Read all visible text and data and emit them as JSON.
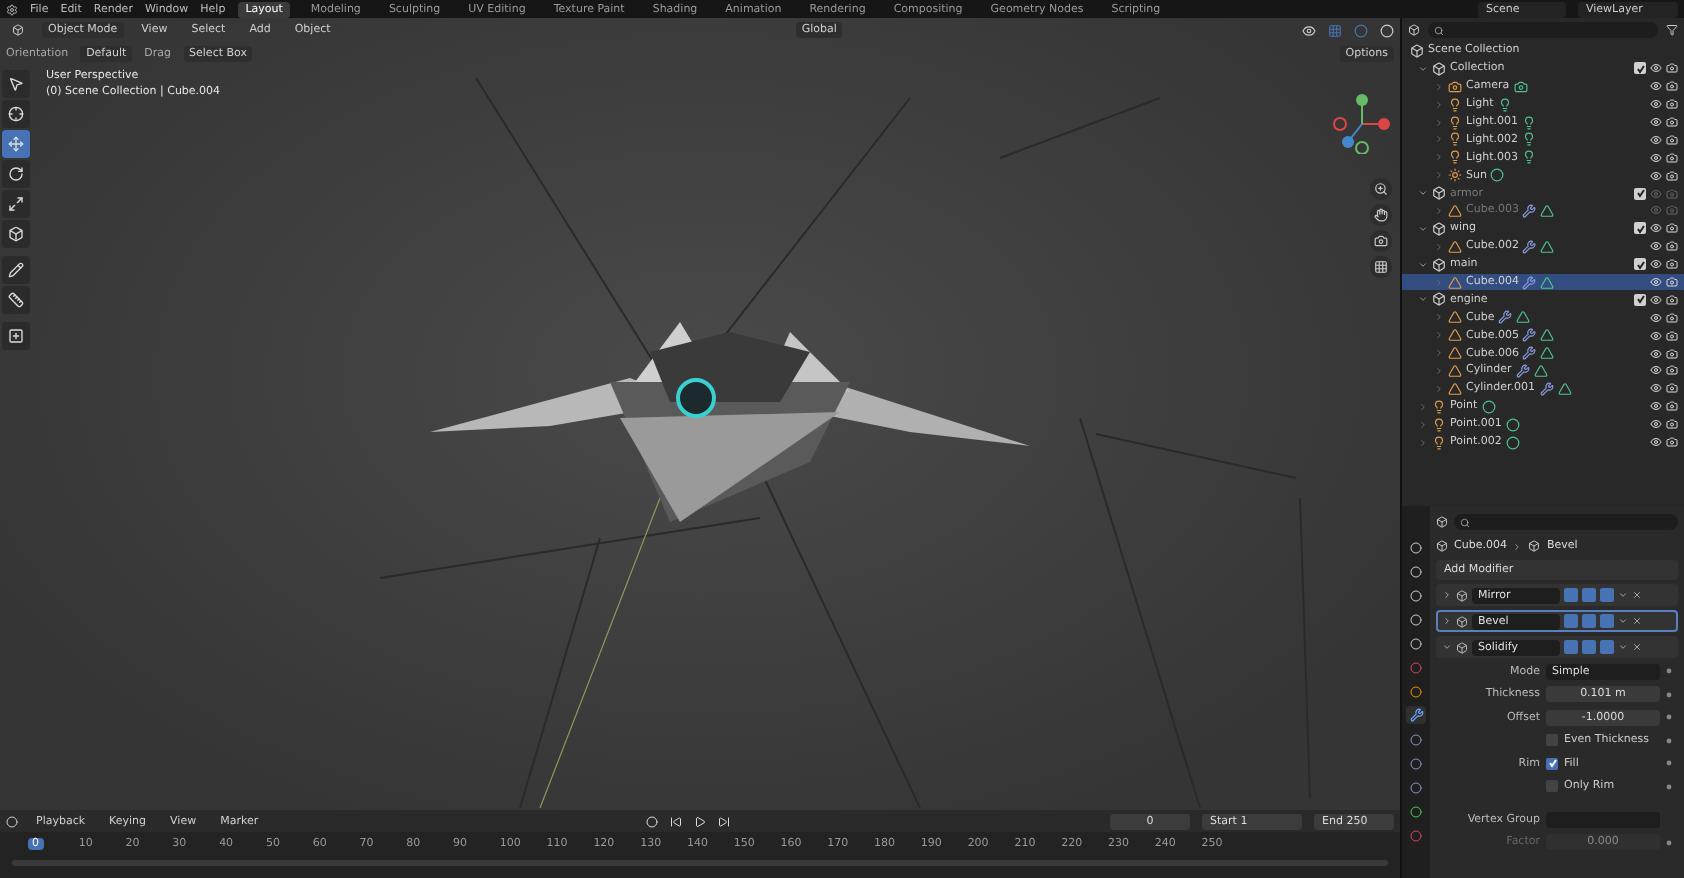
{
  "top_bar": {
    "menus": [
      "File",
      "Edit",
      "Render",
      "Window",
      "Help"
    ],
    "workspaces": [
      {
        "label": "Layout",
        "selected": true
      },
      {
        "label": "Modeling",
        "selected": false
      },
      {
        "label": "Sculpting",
        "selected": false
      },
      {
        "label": "UV Editing",
        "selected": false
      },
      {
        "label": "Texture Paint",
        "selected": false
      },
      {
        "label": "Shading",
        "selected": false
      },
      {
        "label": "Animation",
        "selected": false
      },
      {
        "label": "Rendering",
        "selected": false
      },
      {
        "label": "Compositing",
        "selected": false
      },
      {
        "label": "Geometry Nodes",
        "selected": false
      },
      {
        "label": "Scripting",
        "selected": false
      }
    ],
    "scene": "Scene",
    "view_layer": "ViewLayer"
  },
  "viewport": {
    "mode": "Object Mode",
    "menus": [
      "View",
      "Select",
      "Add",
      "Object"
    ],
    "transform": "Global",
    "orientation_label": "Orientation",
    "orientation": "Default",
    "drag_label": "Drag",
    "drag": "Select Box",
    "options": "Options",
    "perspective": "User Perspective",
    "context": "(0) Scene Collection | Cube.004",
    "tools": [
      {
        "kind": "select",
        "selected": false
      },
      {
        "kind": "cursor",
        "selected": false
      },
      {
        "kind": "move",
        "selected": true
      },
      {
        "kind": "rotate",
        "selected": false
      },
      {
        "kind": "scale",
        "selected": false
      },
      {
        "kind": "transform",
        "selected": false
      },
      {
        "kind": "annotate",
        "selected": false
      },
      {
        "kind": "measure",
        "selected": false
      },
      {
        "kind": "add",
        "selected": false
      }
    ]
  },
  "outliner": {
    "root": "Scene Collection",
    "items": [
      {
        "label": "Collection",
        "kind": "collection",
        "checked": true,
        "selected": false,
        "disabled": false,
        "children": [
          {
            "label": "Camera",
            "kind": "camera",
            "selected": false,
            "disabled": false
          },
          {
            "label": "Light",
            "kind": "light",
            "selected": false,
            "disabled": false
          },
          {
            "label": "Light.001",
            "kind": "light",
            "selected": false,
            "disabled": false
          },
          {
            "label": "Light.002",
            "kind": "light",
            "selected": false,
            "disabled": false
          },
          {
            "label": "Light.003",
            "kind": "light",
            "selected": false,
            "disabled": false
          },
          {
            "label": "Sun",
            "kind": "sun",
            "selected": false,
            "disabled": false
          }
        ]
      },
      {
        "label": "armor",
        "kind": "collection",
        "checked": true,
        "selected": false,
        "disabled": true,
        "children": [
          {
            "label": "Cube.003",
            "kind": "mesh",
            "selected": false,
            "disabled": true
          }
        ]
      },
      {
        "label": "wing",
        "kind": "collection",
        "checked": true,
        "selected": false,
        "disabled": false,
        "children": [
          {
            "label": "Cube.002",
            "kind": "mesh",
            "selected": false,
            "disabled": false
          }
        ]
      },
      {
        "label": "main",
        "kind": "collection",
        "checked": true,
        "selected": false,
        "disabled": false,
        "children": [
          {
            "label": "Cube.004",
            "kind": "mesh",
            "selected": true,
            "disabled": false
          }
        ]
      },
      {
        "label": "engine",
        "kind": "collection",
        "checked": true,
        "selected": false,
        "disabled": false,
        "children": [
          {
            "label": "Cube",
            "kind": "mesh",
            "selected": false,
            "disabled": false
          },
          {
            "label": "Cube.005",
            "kind": "mesh",
            "selected": false,
            "disabled": false
          },
          {
            "label": "Cube.006",
            "kind": "mesh",
            "selected": false,
            "disabled": false
          },
          {
            "label": "Cylinder",
            "kind": "mesh",
            "selected": false,
            "disabled": false
          },
          {
            "label": "Cylinder.001",
            "kind": "mesh",
            "selected": false,
            "disabled": false
          }
        ]
      },
      {
        "label": "Point",
        "kind": "point",
        "selected": false,
        "disabled": false
      },
      {
        "label": "Point.001",
        "kind": "point",
        "selected": false,
        "disabled": false
      },
      {
        "label": "Point.002",
        "kind": "point",
        "selected": false,
        "disabled": false
      }
    ]
  },
  "properties": {
    "tabs": [
      {
        "kind": "tool",
        "selected": false
      },
      {
        "kind": "render",
        "selected": false
      },
      {
        "kind": "output",
        "selected": false
      },
      {
        "kind": "view_layer",
        "selected": false
      },
      {
        "kind": "scene",
        "selected": false
      },
      {
        "kind": "world",
        "selected": false
      },
      {
        "kind": "object",
        "selected": false
      },
      {
        "kind": "modifier",
        "selected": true
      },
      {
        "kind": "particles",
        "selected": false
      },
      {
        "kind": "physics",
        "selected": false
      },
      {
        "kind": "constraints",
        "selected": false
      },
      {
        "kind": "data",
        "selected": false
      },
      {
        "kind": "material",
        "selected": false
      }
    ],
    "object": "Cube.004",
    "modifier": "Bevel",
    "add_modifier": "Add Modifier",
    "modifiers": [
      {
        "name": "Mirror",
        "expanded": false,
        "selected": false
      },
      {
        "name": "Bevel",
        "expanded": false,
        "selected": true
      },
      {
        "name": "Solidify",
        "expanded": true,
        "selected": false
      }
    ],
    "fields": [
      {
        "kind": "dropdown",
        "label": "Mode",
        "value": "Simple"
      },
      {
        "kind": "number",
        "label": "Thickness",
        "value": "0.101 m"
      },
      {
        "kind": "number",
        "label": "Offset",
        "value": "-1.0000"
      },
      {
        "kind": "checkbox",
        "text": "Even Thickness",
        "checked": false
      },
      {
        "kind": "checkbox",
        "label": "Rim",
        "text": "Fill",
        "checked": true
      },
      {
        "kind": "checkbox",
        "text": "Only Rim",
        "checked": false
      },
      {
        "kind": "group",
        "label": "Vertex Group"
      },
      {
        "kind": "number",
        "label": "Factor",
        "value": "0.000",
        "disabled": true
      }
    ]
  },
  "timeline": {
    "menus": [
      "Playback",
      "Keying",
      "View",
      "Marker"
    ],
    "current_frame": "0",
    "start_label": "Start",
    "start": "1",
    "end_label": "End",
    "end": "250",
    "ticks": [
      {
        "label": "0",
        "selected": true
      },
      {
        "label": "10",
        "selected": false
      },
      {
        "label": "20",
        "selected": false
      },
      {
        "label": "30",
        "selected": false
      },
      {
        "label": "40",
        "selected": false
      },
      {
        "label": "50",
        "selected": false
      },
      {
        "label": "60",
        "selected": false
      },
      {
        "label": "70",
        "selected": false
      },
      {
        "label": "80",
        "selected": false
      },
      {
        "label": "90",
        "selected": false
      },
      {
        "label": "100",
        "selected": false
      },
      {
        "label": "110",
        "selected": false
      },
      {
        "label": "120",
        "selected": false
      },
      {
        "label": "130",
        "selected": false
      },
      {
        "label": "140",
        "selected": false
      },
      {
        "label": "150",
        "selected": false
      },
      {
        "label": "160",
        "selected": false
      },
      {
        "label": "170",
        "selected": false
      },
      {
        "label": "180",
        "selected": false
      },
      {
        "label": "190",
        "selected": false
      },
      {
        "label": "200",
        "selected": false
      },
      {
        "label": "210",
        "selected": false
      },
      {
        "label": "220",
        "selected": false
      },
      {
        "label": "230",
        "selected": false
      },
      {
        "label": "240",
        "selected": false
      },
      {
        "label": "250",
        "selected": false
      }
    ]
  }
}
